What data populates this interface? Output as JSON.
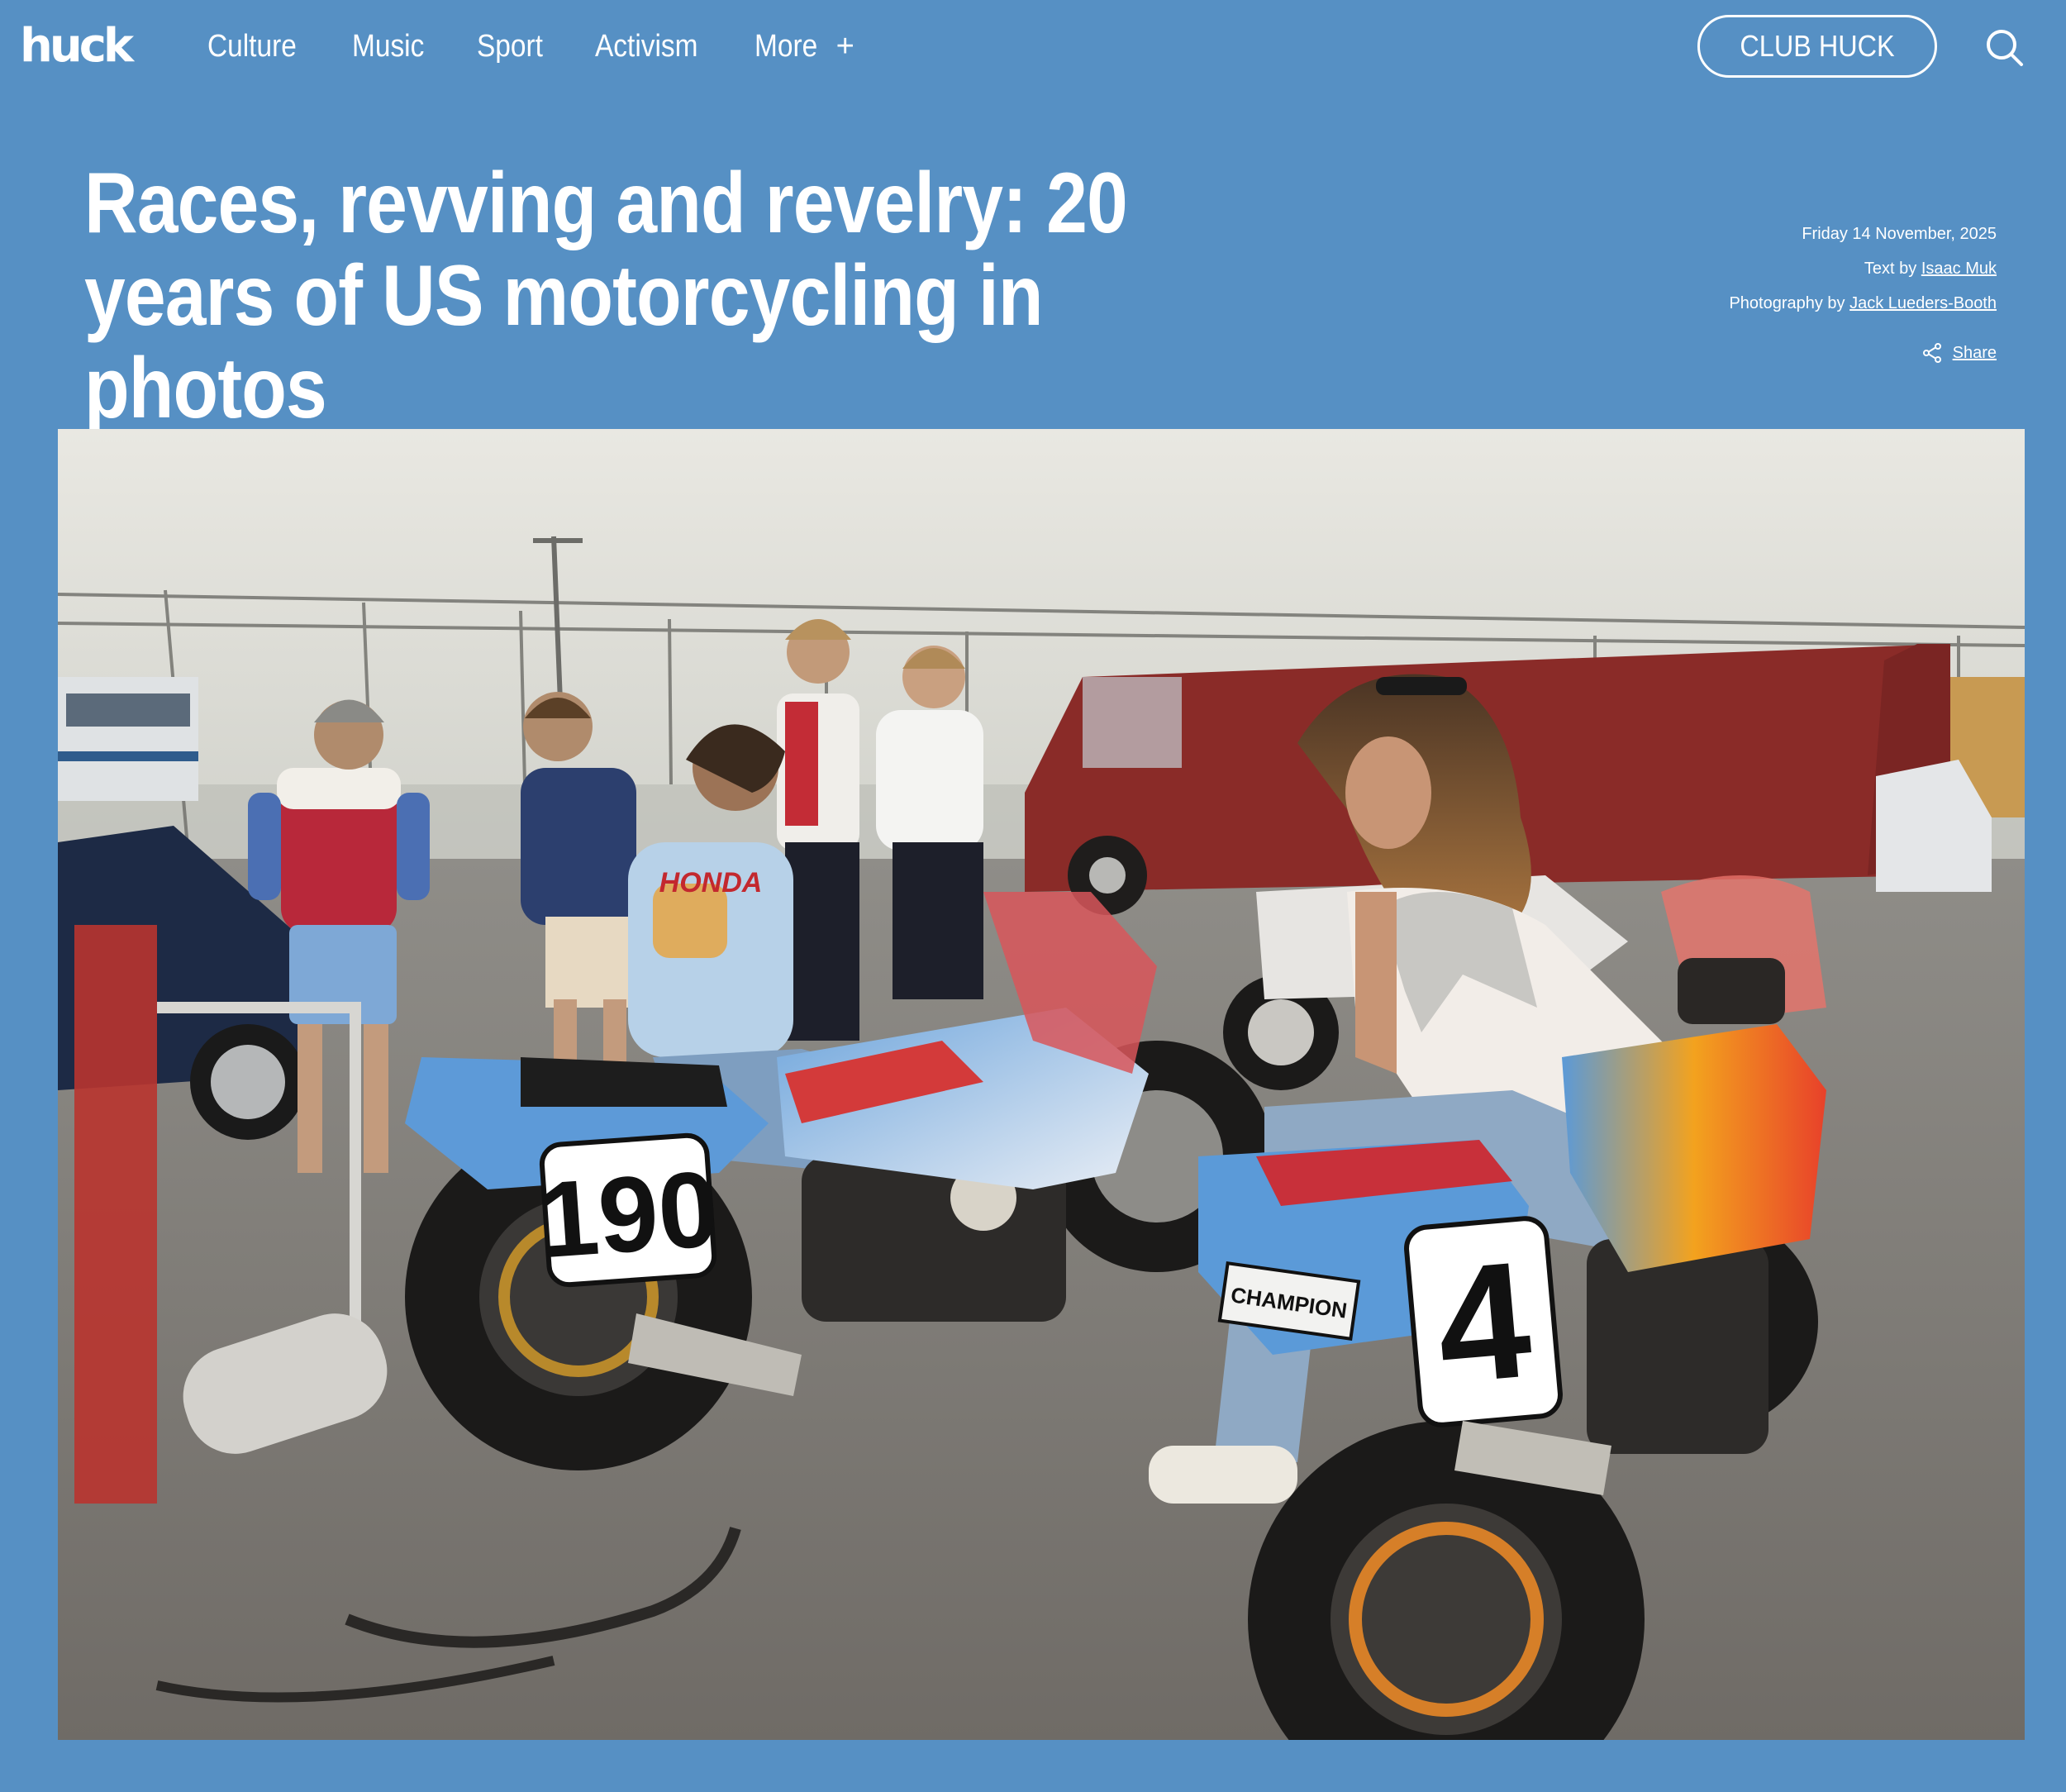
{
  "site": {
    "logo": "huck"
  },
  "nav": {
    "items": [
      {
        "label": "Culture"
      },
      {
        "label": "Music"
      },
      {
        "label": "Sport"
      },
      {
        "label": "Activism"
      }
    ],
    "more_label": "More",
    "more_icon": "plus-icon"
  },
  "header": {
    "club_button_label": "CLUB HUCK",
    "search_icon": "search-icon"
  },
  "article": {
    "title": "Races, revving and revelry: 20 years of US motorcycling in photos",
    "date": "Friday 14 November, 2025",
    "text_prefix": "Text by",
    "author": "Isaac Muk",
    "photo_prefix": "Photography by",
    "photographer": "Jack Lueders-Booth",
    "share_label": "Share",
    "share_icon": "share-icon"
  },
  "hero": {
    "bike_number_left": "190",
    "bike_number_right": "4",
    "decal_left": "HONDA",
    "decal_right": "CHAMPION"
  },
  "colors": {
    "background": "#5690c4",
    "text": "#ffffff"
  }
}
